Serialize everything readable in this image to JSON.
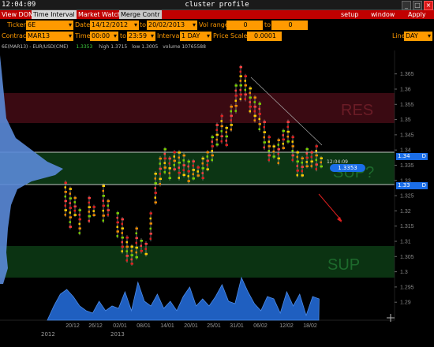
{
  "titlebar": {
    "clock": "12:04:09",
    "title": "cluster profile",
    "buttons": [
      "_",
      "□",
      "×"
    ]
  },
  "menubar": {
    "tabs": [
      "View DOM",
      "Time Interval",
      "Market Watch",
      "Merge Contr"
    ],
    "menu": [
      "setup",
      "window",
      "Apply"
    ]
  },
  "form": {
    "ticker_label": "Ticker",
    "ticker": "6E",
    "date_label": "Date",
    "date_from": "14/12/2012",
    "to1": "to",
    "date_to": "20/02/2013",
    "vol_label": "Vol range",
    "vol_from": "0",
    "to2": "to",
    "vol_to": "0",
    "contract_label": "Contract",
    "contract": "MAR13",
    "time_label": "Time",
    "time_from": "00:00",
    "to3": "to",
    "time_to": "23:59",
    "interval_label": "Interval",
    "interval": "1 DAY",
    "pricescale_label": "Price Scale",
    "pricescale": "0.0001",
    "line_label": "Line",
    "line": "DAY"
  },
  "chart": {
    "instrument": "6E(MAR13) - EUR/USD(CME)",
    "last": "1.3353",
    "high": "high 1.3715",
    "low": "low 1.3005",
    "volume": "volume 10765588",
    "zones": [
      "RES",
      "SUP?",
      "SUP"
    ],
    "y_ticks": [
      "1.365",
      "1.36",
      "1.355",
      "1.35",
      "1.345",
      "1.34",
      "1.335",
      "1.33",
      "1.325",
      "1.32",
      "1.315",
      "1.31",
      "1.305",
      "1.3",
      "1.295",
      "1.29"
    ],
    "x_ticks": [
      "20/12",
      "26/12",
      "02/01",
      "08/01",
      "14/01",
      "20/01",
      "25/01",
      "31/01",
      "06/02",
      "12/02",
      "18/02"
    ],
    "years": [
      "2012",
      "2013"
    ],
    "badge_upper": "1.34",
    "badge_lower": "1.33",
    "badge_marker": "D",
    "price_badge": "1.3353",
    "price_time": "12:04:09",
    "colors": {
      "res": "#3a0a10",
      "sup": "#0b3312",
      "volume": "#1f5fc0",
      "accent": "#ff9a00",
      "badge": "#1b6ee8"
    }
  }
}
